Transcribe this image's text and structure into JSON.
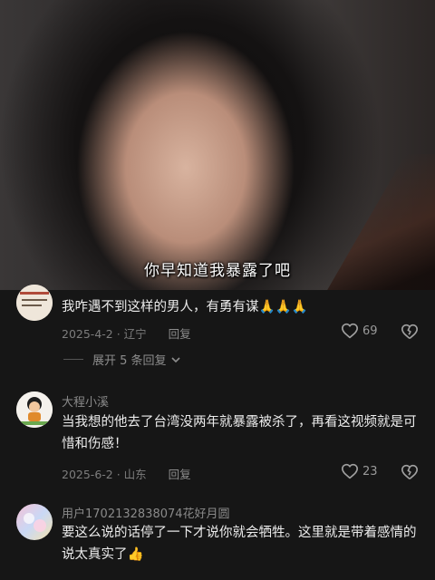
{
  "video": {
    "subtitle": "你早知道我暴露了吧"
  },
  "comments": [
    {
      "username": "",
      "text": "我咋遇不到这样的男人，有勇有谋🙏🙏🙏",
      "date_location": "2025-4-2 · 辽宁",
      "reply_label": "回复",
      "likes": "69",
      "expand_label": "展开 5 条回复"
    },
    {
      "username": "大程小溪",
      "text": "当我想的他去了台湾没两年就暴露被杀了，再看这视频就是可惜和伤感！",
      "date_location": "2025-6-2 · 山东",
      "reply_label": "回复",
      "likes": "23"
    },
    {
      "username": "用户1702132838074花好月圆",
      "text": "要这么说的话停了一下才说你就会牺牲。这里就是带着感情的说太真实了👍",
      "date_location": "",
      "reply_label": "",
      "likes": ""
    }
  ],
  "icons": {
    "like": "heart-outline-icon",
    "dislike": "broken-heart-icon",
    "expand": "chevron-down-icon"
  },
  "colors": {
    "background": "#161616",
    "text": "#ececec",
    "muted": "#7d7d7d"
  }
}
